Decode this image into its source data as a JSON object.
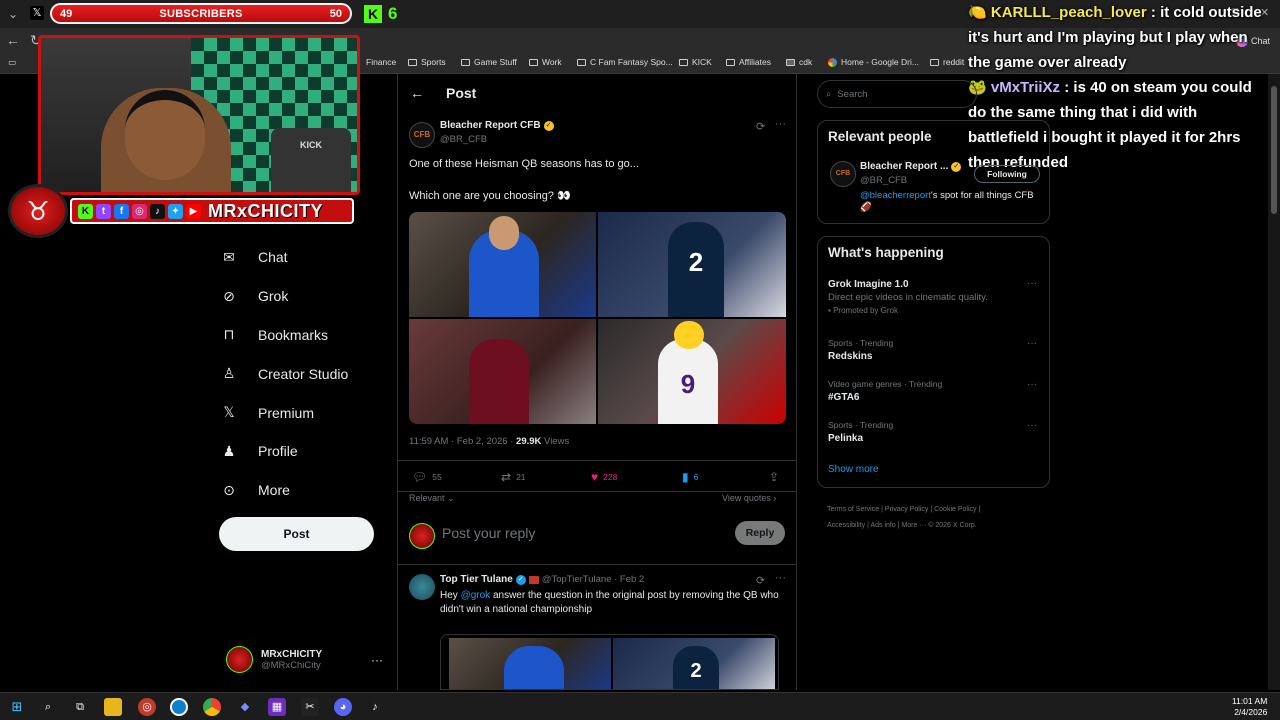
{
  "overlay": {
    "subscribers_current": "49",
    "subscribers_label": "SUBSCRIBERS",
    "subscribers_goal": "50",
    "kick_count": "6",
    "channel_name": "MRxCHICITY",
    "cam_shirt_text": "KICK",
    "chat": [
      {
        "user": "KARLLL_peach_lover",
        "message": "it cold outside it's hurt and I'm playing but I play when the game over already"
      },
      {
        "user": "vMxTriiXz",
        "message": "is 40 on steam you could do the same thing that i did with battlefield i bought it played it for 2hrs then refunded"
      }
    ]
  },
  "browser": {
    "bookmarks": [
      "Finance",
      "Sports",
      "Game Stuff",
      "Work",
      "C Fam Fantasy Spo...",
      "KICK",
      "Affiliates",
      "cdk",
      "Home - Google Dri...",
      "reddit"
    ],
    "chat_button": "Chat"
  },
  "nav": {
    "items": [
      {
        "label": "Chat",
        "icon": "mail-icon"
      },
      {
        "label": "Grok",
        "icon": "grok-icon"
      },
      {
        "label": "Bookmarks",
        "icon": "bookmark-icon"
      },
      {
        "label": "Creator Studio",
        "icon": "creator-studio-icon"
      },
      {
        "label": "Premium",
        "icon": "x-logo-icon"
      },
      {
        "label": "Profile",
        "icon": "person-icon"
      },
      {
        "label": "More",
        "icon": "more-circle-icon"
      }
    ],
    "post_button": "Post",
    "account_name": "MRxCHICITY",
    "account_handle": "@MRxChiCity"
  },
  "main": {
    "title": "Post",
    "tweet": {
      "author": "Bleacher Report CFB",
      "handle": "@BR_CFB",
      "text_line1": "One of these Heisman QB seasons has to go...",
      "text_line2": "Which one are you choosing? 👀",
      "timestamp": "11:59 AM · Feb 2, 2026 · ",
      "views_count": "29.9K",
      "views_label": " Views",
      "replies": "55",
      "reposts": "21",
      "likes": "228",
      "bookmarks": "6"
    },
    "relevant_label": "Relevant",
    "view_quotes": "View quotes",
    "reply_placeholder": "Post your reply",
    "reply_button": "Reply",
    "reply_tweet": {
      "author": "Top Tier Tulane",
      "handle": "@TopTierTulane · Feb 2",
      "mention": "@grok",
      "text_pre": "Hey ",
      "text_post": " answer the question in the original post by removing the QB who didn't win a national championship"
    }
  },
  "right": {
    "search_placeholder": "Search",
    "relevant_title": "Relevant people",
    "person_name": "Bleacher Report ...",
    "person_handle": "@BR_CFB",
    "person_bio_link": "@bleacherreport",
    "person_bio": "'s spot for all things CFB 🏈",
    "follow_label": "Following",
    "happening_title": "What's happening",
    "trends": [
      {
        "category": "",
        "title": "Grok Imagine 1.0",
        "sub": "Direct epic videos in cinematic quality.",
        "promo": "Promoted by Grok"
      },
      {
        "category": "Sports · Trending",
        "title": "Redskins",
        "sub": "",
        "promo": ""
      },
      {
        "category": "Video game genres · Trending",
        "title": "#GTA6",
        "sub": "",
        "promo": ""
      },
      {
        "category": "Sports · Trending",
        "title": "Pelinka",
        "sub": "",
        "promo": ""
      }
    ],
    "show_more": "Show more",
    "footer_line1": "Terms of Service  |  Privacy Policy  |  Cookie Policy  |",
    "footer_line2": "Accessibility  |  Ads info  |  More ···  © 2026 X Corp."
  },
  "taskbar": {
    "time": "11:01 AM",
    "date": "2/4/2026"
  },
  "colors": {
    "accent": "#1d9bf0",
    "like": "#f91880",
    "overlay_red": "#c40e0e",
    "kick_green": "#53fc18"
  }
}
